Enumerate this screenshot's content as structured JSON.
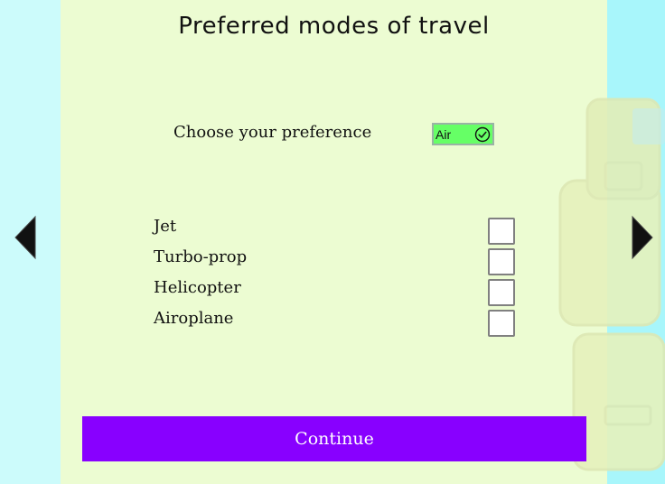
{
  "page": {
    "title": "Preferred modes of travel"
  },
  "preference": {
    "label": "Choose your preference",
    "selected": "Air",
    "icon": "check-circle-icon"
  },
  "options": [
    {
      "label": "Jet",
      "checked": false
    },
    {
      "label": "Turbo-prop",
      "checked": false
    },
    {
      "label": "Helicopter",
      "checked": false
    },
    {
      "label": "Airoplane",
      "checked": false
    }
  ],
  "nav": {
    "prev_icon": "triangle-left-icon",
    "next_icon": "triangle-right-icon"
  },
  "continue_label": "Continue",
  "colors": {
    "background": "#ccfbfb",
    "panel": "#ecfcd2",
    "right_band": "#a8f6fb",
    "select_fill": "#66ff66",
    "button": "#8800ff",
    "button_text": "#ffffff"
  }
}
